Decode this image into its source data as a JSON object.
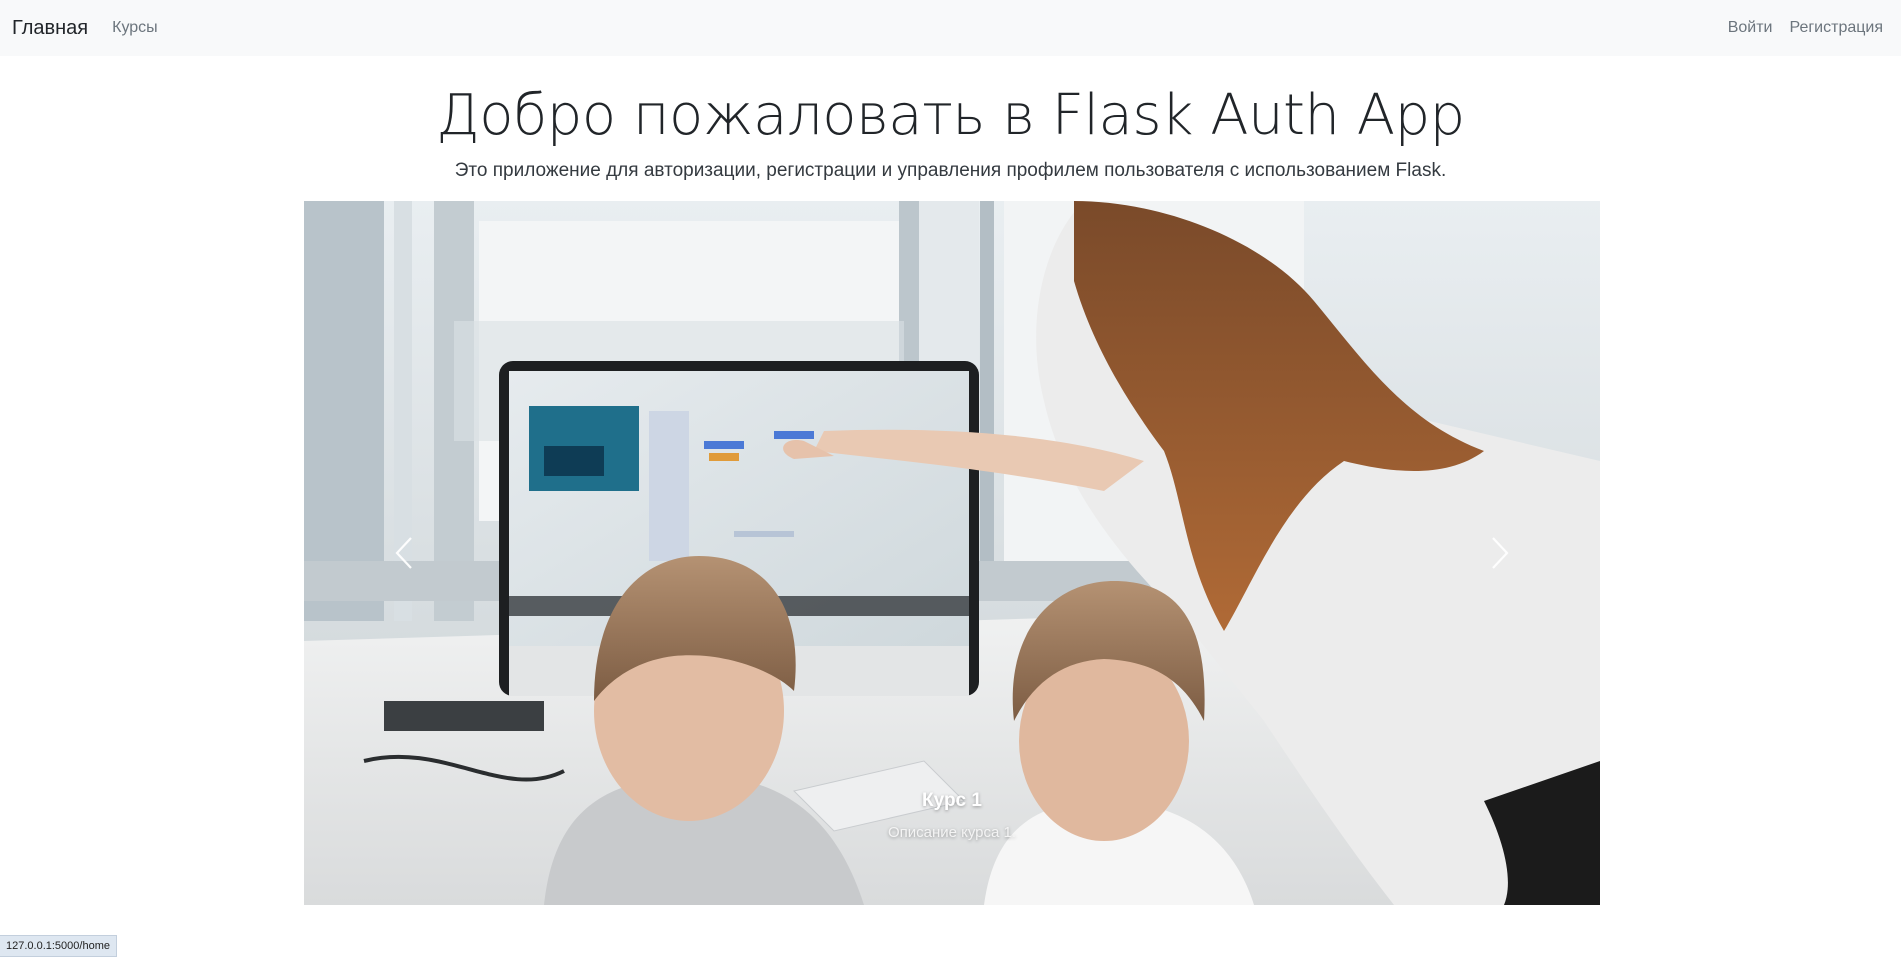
{
  "navbar": {
    "brand": "Главная",
    "links": [
      "Курсы"
    ],
    "right_links": [
      "Войти",
      "Регистрация"
    ]
  },
  "hero": {
    "title": "Добро пожаловать в Flask Auth App",
    "lead": "Это приложение для авторизации, регистрации и управления профилем пользователя с использованием Flask."
  },
  "carousel": {
    "slides": [
      {
        "caption_title": "Курс 1",
        "caption_text": "Описание курса 1."
      }
    ],
    "prev_icon": "chevron-left-icon",
    "next_icon": "chevron-right-icon"
  },
  "status_bar": {
    "url": "127.0.0.1:5000/home"
  }
}
